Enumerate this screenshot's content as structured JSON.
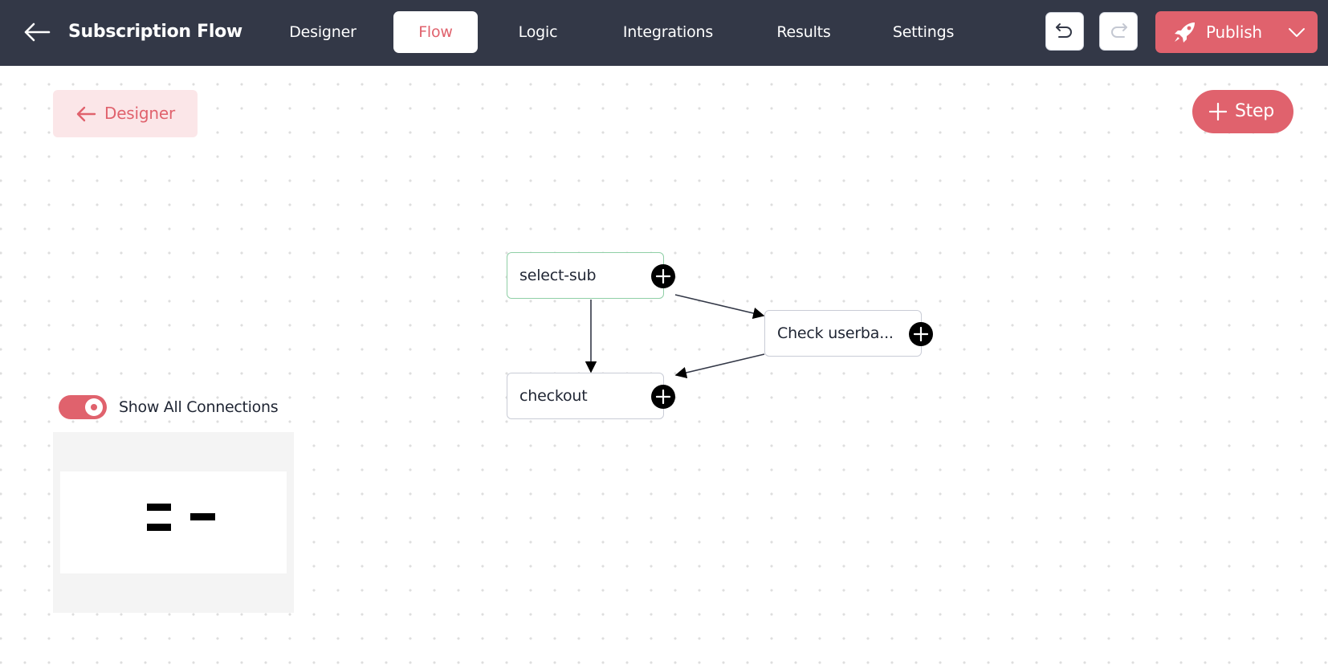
{
  "header": {
    "back_icon": "arrow-left-icon",
    "title": "Subscription Flow",
    "tabs": [
      {
        "label": "Designer",
        "active": false
      },
      {
        "label": "Flow",
        "active": true
      },
      {
        "label": "Logic",
        "active": false
      },
      {
        "label": "Integrations",
        "active": false
      },
      {
        "label": "Results",
        "active": false
      },
      {
        "label": "Settings",
        "active": false
      }
    ],
    "undo_icon": "undo-icon",
    "redo_icon": "redo-icon",
    "redo_enabled": false,
    "publish": {
      "label": "Publish",
      "icon": "rocket-icon",
      "menu_icon": "chevron-down-icon"
    }
  },
  "toolbar": {
    "back_to_designer_label": "Designer",
    "add_step_label": "Step"
  },
  "flow": {
    "nodes": [
      {
        "id": "select-sub",
        "label": "select-sub",
        "selected": true
      },
      {
        "id": "check-userbase",
        "label": "Check userba...",
        "selected": false
      },
      {
        "id": "checkout",
        "label": "checkout",
        "selected": false
      }
    ],
    "edges": [
      {
        "from": "select-sub",
        "to": "checkout"
      },
      {
        "from": "select-sub",
        "to": "check-userbase"
      },
      {
        "from": "check-userbase",
        "to": "checkout"
      }
    ]
  },
  "connections_toggle": {
    "label": "Show All Connections",
    "on": true
  },
  "colors": {
    "header_bg": "#333847",
    "accent": "#e0626d",
    "accent_light": "#fbe6e8",
    "selected_node_border": "#8fcfa6"
  }
}
